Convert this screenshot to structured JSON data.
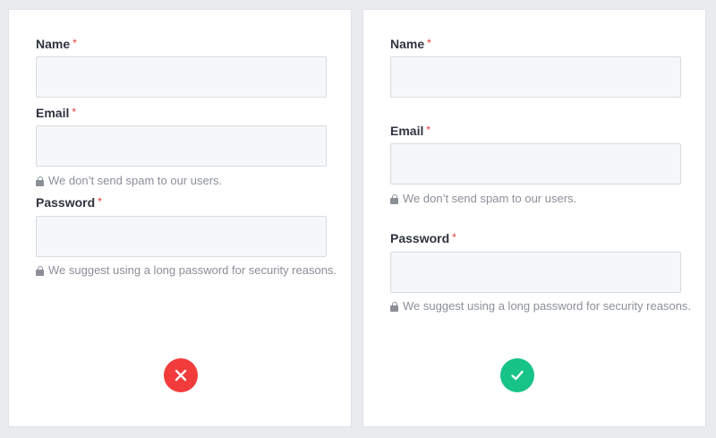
{
  "colors": {
    "wrong": "#f23b3b",
    "right": "#17c387",
    "required": "#e53935",
    "background": "#e9ebef"
  },
  "wrong_example": {
    "name_label": "Name",
    "email_label": "Email",
    "email_hint": "We don’t send spam to our users.",
    "password_label": "Password",
    "password_hint": "We suggest using a long password for security reasons.",
    "required_mark": "*",
    "result_icon": "close-icon"
  },
  "right_example": {
    "name_label": "Name",
    "email_label": "Email",
    "email_hint": "We don’t send spam to our users.",
    "password_label": "Password",
    "password_hint": "We suggest using a long password for security reasons.",
    "required_mark": "*",
    "result_icon": "check-icon"
  }
}
